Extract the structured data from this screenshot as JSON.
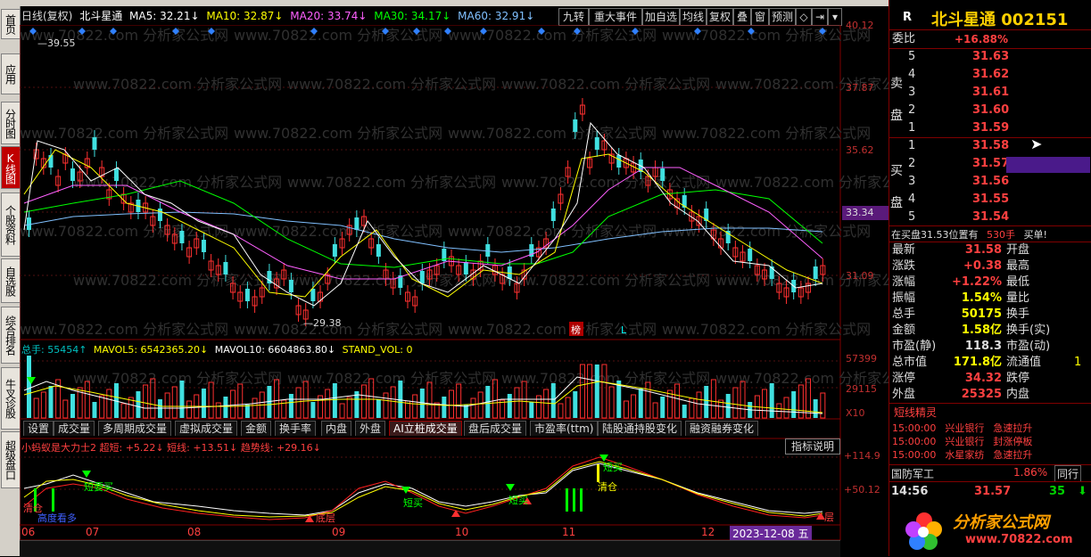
{
  "leftbar": {
    "items": [
      "首页",
      "应用",
      "分时图",
      "K线图",
      "个股资料",
      "自选股",
      "综合排名",
      "牛叉诊股",
      "超级盘口"
    ]
  },
  "header": {
    "period": "日线(复权)",
    "stock_name": "北斗星通",
    "ma5": "MA5: 32.21↓",
    "ma10": "MA10: 32.87↓",
    "ma20": "MA20: 33.74↓",
    "ma30": "MA30: 34.17↓",
    "ma60": "MA60: 32.91↓",
    "buttons": [
      "九转",
      "重大事件",
      "加自选",
      "均线",
      "复权",
      "叠",
      "窗",
      "预测"
    ]
  },
  "price_axis": [
    "40.12",
    "37.87",
    "35.62",
    "33.34",
    "31.09"
  ],
  "price_annotations": {
    "high": "39.55",
    "low": "29.38",
    "badge": "榜",
    "label_L": "L"
  },
  "volume": {
    "summary_total": "总手: 55454↑",
    "mavol5": "MAVOL5: 6542365.20↓",
    "mavol10": "MAVOL10: 6604863.80↓",
    "stand": "STAND_VOL: 0",
    "axis": [
      "57399",
      "29115",
      "X10"
    ]
  },
  "tabs": [
    "设置",
    "成交量",
    "多周期成交量",
    "虚拟成交量",
    "金额",
    "换手率",
    "内盘",
    "外盘",
    "AI立桩成交量",
    "盘后成交量",
    "市盈率(ttm)",
    "陆股通持股变化",
    "融资融券变化"
  ],
  "indicator": {
    "title": "小蚂蚁是大力士2 超短: +5.22↓ 短线: +13.51↓ 趋势线: +29.16↓",
    "button": "指标说明",
    "axis": [
      "+114.9",
      "+50.12"
    ],
    "labels": [
      "清仓",
      "短要买",
      "短买",
      "短买",
      "清仓",
      "短买",
      "高度看多",
      "底层",
      "层"
    ]
  },
  "xaxis": {
    "ticks": [
      "06",
      "07",
      "08",
      "09",
      "10",
      "11",
      "12"
    ],
    "date_box": "2023-12-08 五"
  },
  "watermark": "www.70822.com 分析家公式网",
  "right_panel": {
    "r_label": "R",
    "title": "北斗星通 002151",
    "weibi_label": "委比",
    "weibi_value": "+16.88%",
    "sell_label": "卖盘",
    "buy_label": "买盘",
    "sell": [
      [
        "5",
        "31.63"
      ],
      [
        "4",
        "31.62"
      ],
      [
        "3",
        "31.61"
      ],
      [
        "2",
        "31.60"
      ],
      [
        "1",
        "31.59"
      ]
    ],
    "buy": [
      [
        "1",
        "31.58"
      ],
      [
        "2",
        "31.57"
      ],
      [
        "3",
        "31.56"
      ],
      [
        "4",
        "31.55"
      ],
      [
        "5",
        "31.54"
      ]
    ],
    "notice": "在买盘31.53位置有",
    "notice_qty": "530手",
    "notice_suffix": "买单!",
    "stats": [
      [
        "最新",
        "31.58",
        "开盘",
        ""
      ],
      [
        "涨跌",
        "+0.38",
        "最高",
        ""
      ],
      [
        "涨幅",
        "+1.22%",
        "最低",
        ""
      ],
      [
        "振幅",
        "1.54%",
        "量比",
        ""
      ],
      [
        "总手",
        "50175",
        "换手",
        ""
      ],
      [
        "金额",
        "1.58亿",
        "换手(实)",
        ""
      ],
      [
        "市盈(静)",
        "118.3",
        "市盈(动)",
        ""
      ],
      [
        "总市值",
        "171.8亿",
        "流通值",
        "1"
      ],
      [
        "涨停",
        "34.32",
        "跌停",
        ""
      ],
      [
        "外盘",
        "25325",
        "内盘",
        ""
      ]
    ],
    "jingling_title": "短线精灵",
    "jingling": [
      [
        "15:00:00",
        "兴业银行",
        "急速拉升"
      ],
      [
        "15:00:00",
        "兴业银行",
        "封涨停板"
      ],
      [
        "15:00:00",
        "水星家纺",
        "急速拉升"
      ]
    ],
    "sector_name": "国防军工",
    "sector_pct": "1.86%",
    "sector_btn": "同行",
    "tick_time": "14:56",
    "tick_price": "31.57",
    "tick_vol": "35",
    "logo_text": "分析家公式网",
    "logo_url": "www.70822.com"
  }
}
